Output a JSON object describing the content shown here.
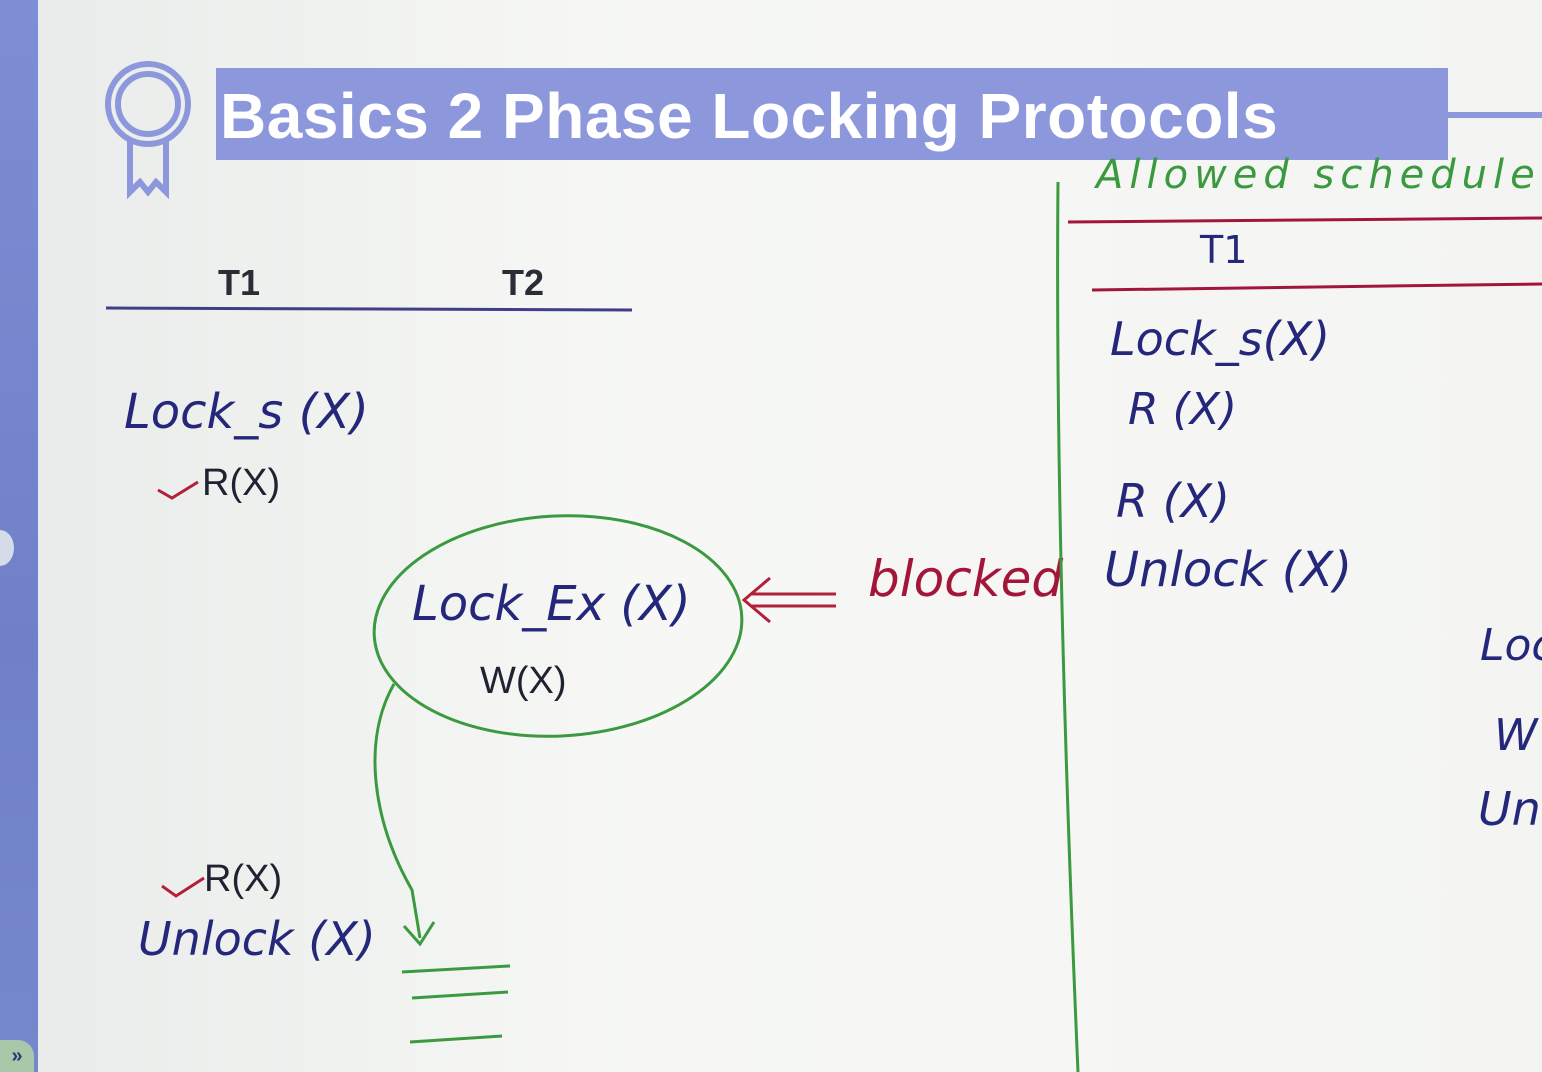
{
  "slide": {
    "title": "Basics 2 Phase Locking Protocols",
    "left_schedule": {
      "col_t1": "T1",
      "col_t2": "T2",
      "t1_lock": "Lock_s (X)",
      "t1_read1": "R(X)",
      "t2_lock": "Lock_Ex (X)",
      "t2_write": "W(X)",
      "blocked_note": "blocked",
      "t1_read2": "R(X)",
      "t1_unlock": "Unlock (X)"
    },
    "right_schedule": {
      "heading": "Allowed schedule",
      "col_t1": "T1",
      "lines": [
        "Lock_s(X)",
        "R (X)",
        "R (X)",
        "Unlock (X)"
      ],
      "partial_lines": [
        "Loc",
        "W",
        "Unl"
      ]
    }
  },
  "colors": {
    "title_bar": "#8d98dc",
    "ink_blue": "#24277a",
    "ink_green": "#3b9a3f",
    "ink_red": "#a3163a"
  },
  "icons": [
    "award-badge-icon",
    "expand-chevron-icon"
  ]
}
